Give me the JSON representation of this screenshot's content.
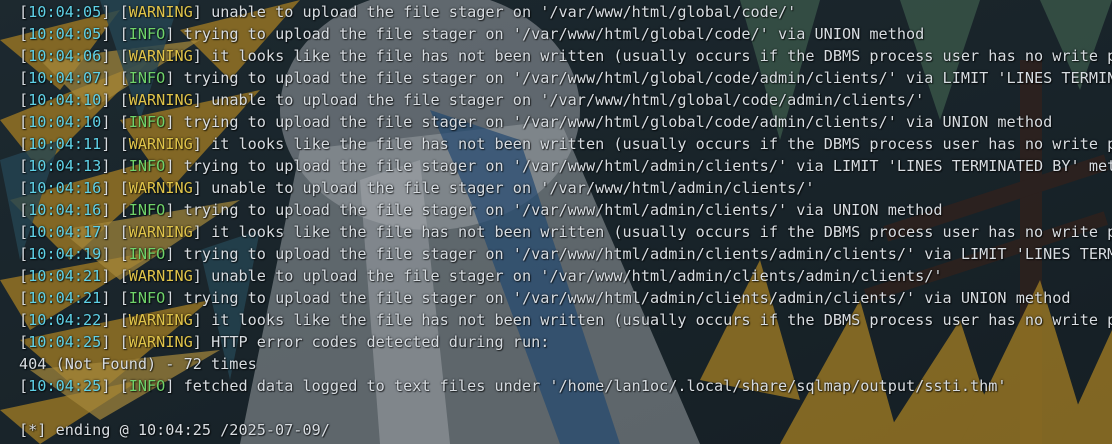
{
  "terminal": {
    "lines": [
      {
        "ts": "10:04:05",
        "level": "WARNING",
        "text": " unable to upload the file stager on '/var/www/html/global/code/'"
      },
      {
        "ts": "10:04:05",
        "level": "INFO",
        "text": " trying to upload the file stager on '/var/www/html/global/code/' via UNION method"
      },
      {
        "ts": "10:04:06",
        "level": "WARNING",
        "text": " it looks like the file has not been written (usually occurs if the DBMS process user has no write pri"
      },
      {
        "ts": "10:04:07",
        "level": "INFO",
        "text": " trying to upload the file stager on '/var/www/html/global/code/admin/clients/' via LIMIT 'LINES TERMINATE"
      },
      {
        "ts": "10:04:10",
        "level": "WARNING",
        "text": " unable to upload the file stager on '/var/www/html/global/code/admin/clients/'"
      },
      {
        "ts": "10:04:10",
        "level": "INFO",
        "text": " trying to upload the file stager on '/var/www/html/global/code/admin/clients/' via UNION method"
      },
      {
        "ts": "10:04:11",
        "level": "WARNING",
        "text": " it looks like the file has not been written (usually occurs if the DBMS process user has no write pri"
      },
      {
        "ts": "10:04:13",
        "level": "INFO",
        "text": " trying to upload the file stager on '/var/www/html/admin/clients/' via LIMIT 'LINES TERMINATED BY' metho"
      },
      {
        "ts": "10:04:16",
        "level": "WARNING",
        "text": " unable to upload the file stager on '/var/www/html/admin/clients/'"
      },
      {
        "ts": "10:04:16",
        "level": "INFO",
        "text": " trying to upload the file stager on '/var/www/html/admin/clients/' via UNION method"
      },
      {
        "ts": "10:04:17",
        "level": "WARNING",
        "text": " it looks like the file has not been written (usually occurs if the DBMS process user has no write pri"
      },
      {
        "ts": "10:04:19",
        "level": "INFO",
        "text": " trying to upload the file stager on '/var/www/html/admin/clients/admin/clients/' via LIMIT 'LINES TERMIN"
      },
      {
        "ts": "10:04:21",
        "level": "WARNING",
        "text": " unable to upload the file stager on '/var/www/html/admin/clients/admin/clients/'"
      },
      {
        "ts": "10:04:21",
        "level": "INFO",
        "text": " trying to upload the file stager on '/var/www/html/admin/clients/admin/clients/' via UNION method"
      },
      {
        "ts": "10:04:22",
        "level": "WARNING",
        "text": " it looks like the file has not been written (usually occurs if the DBMS process user has no write pri"
      },
      {
        "ts": "10:04:25",
        "level": "WARNING",
        "text": " HTTP error codes detected during run:"
      }
    ],
    "plain_line": "404 (Not Found) - 72 times",
    "final_log": {
      "ts": "10:04:25",
      "level": "INFO",
      "text": " fetched data logged to text files under '/home/lan1oc/.local/share/sqlmap/output/ssti.thm'"
    },
    "ending_line": "[*] ending @ 10:04:25 /2025-07-09/"
  },
  "colors": {
    "timestamp": "#5fd2e8",
    "warning": "#e0c44a",
    "info": "#6fd36a",
    "text": "#d8dde2"
  }
}
